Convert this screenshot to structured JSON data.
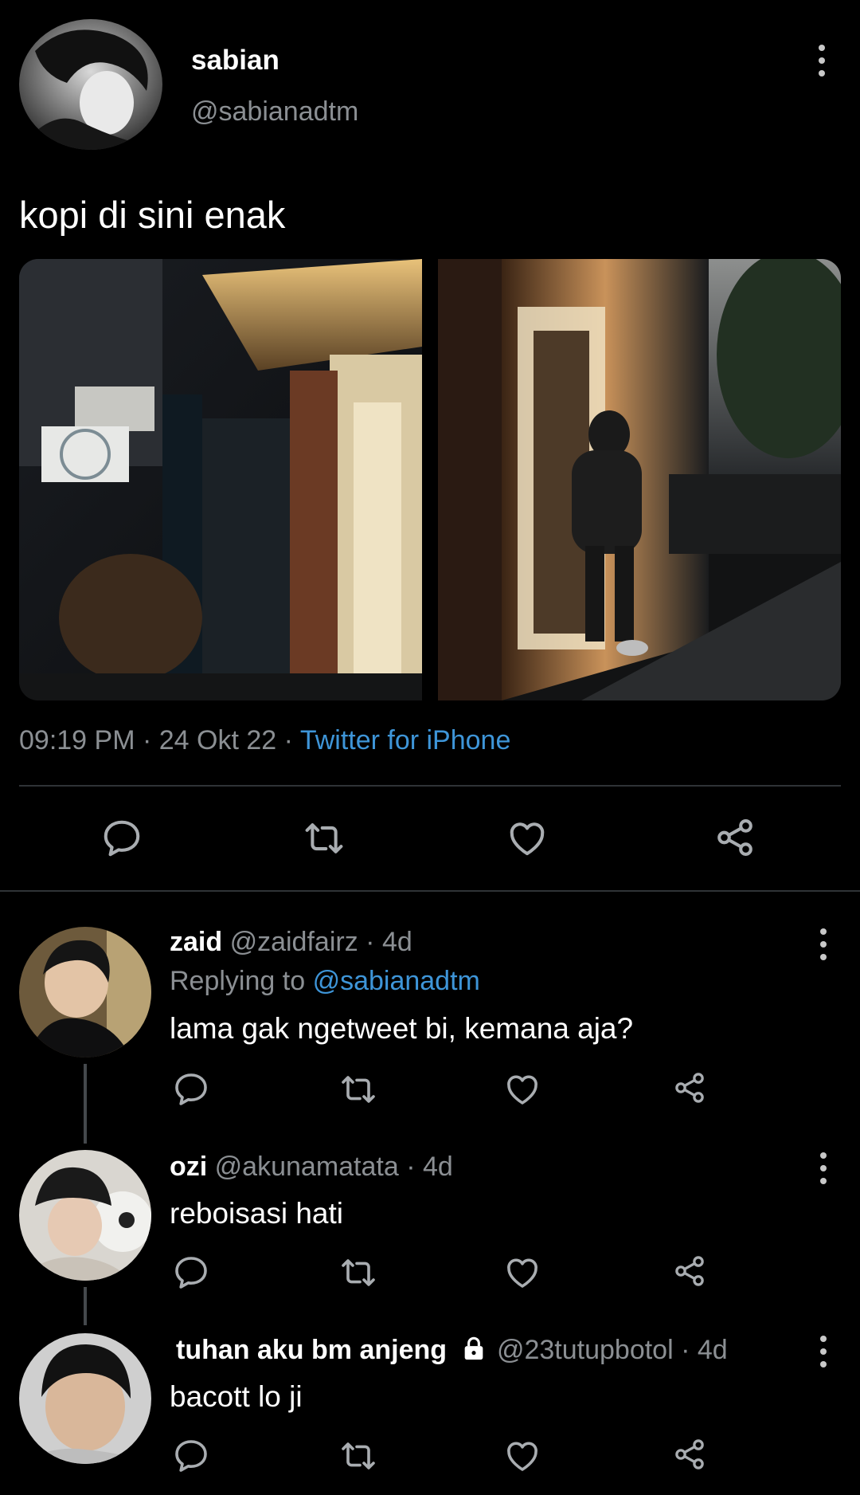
{
  "tweet": {
    "display_name": "sabian",
    "handle": "@sabianadtm",
    "text": "kopi di sini enak",
    "time": "09:19 PM",
    "sep1": "·",
    "date": "24 Okt 22",
    "sep2": "·",
    "source": "Twitter for iPhone"
  },
  "replies": [
    {
      "display_name": "zaid",
      "handle": "@zaidfairz",
      "sep": "·",
      "age": "4d",
      "replying_prefix": "Replying to",
      "replying_handle": "@sabianadtm",
      "text": "lama gak ngetweet bi, kemana aja?"
    },
    {
      "display_name": "ozi",
      "handle": "@akunamatata",
      "sep": "·",
      "age": "4d",
      "text": "reboisasi hati"
    },
    {
      "display_name": "tuhan aku bm anjeng",
      "handle": "@23tutupbotol",
      "sep": "·",
      "age": "4d",
      "text": "bacott lo ji"
    }
  ],
  "icons": {
    "reply": "speech-bubble-icon",
    "retweet": "retweet-icon",
    "like": "heart-icon",
    "share": "share-icon",
    "more": "more-vertical-icon",
    "lock": "lock-icon"
  },
  "colors": {
    "background": "#000000",
    "text": "#e7e9ea",
    "secondary": "#8b8f93",
    "link": "#3e95d8",
    "divider": "#2f3336"
  }
}
